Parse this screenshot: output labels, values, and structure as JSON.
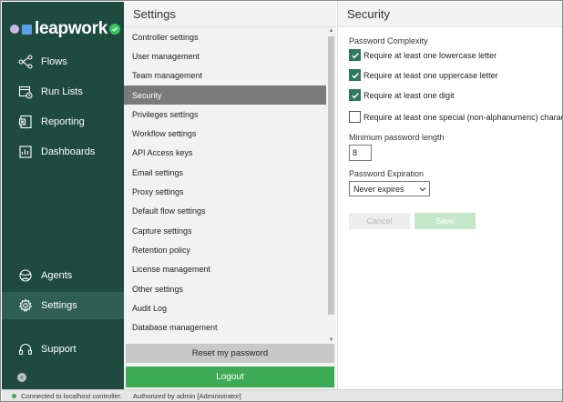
{
  "app": {
    "logo_text": "leapwork"
  },
  "nav": {
    "items": [
      {
        "label": "Flows",
        "icon": "flows-icon"
      },
      {
        "label": "Run Lists",
        "icon": "run-lists-icon"
      },
      {
        "label": "Reporting",
        "icon": "reporting-icon"
      },
      {
        "label": "Dashboards",
        "icon": "dashboards-icon"
      },
      {
        "label": "Agents",
        "icon": "agents-icon"
      },
      {
        "label": "Settings",
        "icon": "settings-gear-icon",
        "active": true
      },
      {
        "label": "Support",
        "icon": "support-icon"
      }
    ]
  },
  "settings": {
    "title": "Settings",
    "items": [
      "Controller settings",
      "User management",
      "Team management",
      "Security",
      "Privileges settings",
      "Workflow settings",
      "API Access keys",
      "Email settings",
      "Proxy settings",
      "Default flow settings",
      "Capture settings",
      "Retention policy",
      "License management",
      "Other settings",
      "Audit Log",
      "Database management"
    ],
    "active_item": "Security",
    "reset_label": "Reset my password",
    "logout_label": "Logout"
  },
  "security": {
    "title": "Security",
    "complexity_label": "Password Complexity",
    "rules": [
      {
        "label": "Require at least one lowercase letter",
        "checked": true
      },
      {
        "label": "Require at least one uppercase letter",
        "checked": true
      },
      {
        "label": "Require at least one digit",
        "checked": true
      },
      {
        "label": "Require at least one special (non-alphanumeric) character",
        "checked": false
      }
    ],
    "min_length_label": "Minimum password length",
    "min_length_value": "8",
    "expiration_label": "Password Expiration",
    "expiration_value": "Never expires",
    "cancel_label": "Cancel",
    "save_label": "Save"
  },
  "status": {
    "connection": "Connected to localhost controller.",
    "auth": "Authorized by  admin [Administrator]"
  },
  "colors": {
    "nav_bg": "#1f4a40",
    "active_setting": "#7a7a7a",
    "checkbox_checked": "#2d7a5a",
    "logout_green": "#3daa55"
  }
}
